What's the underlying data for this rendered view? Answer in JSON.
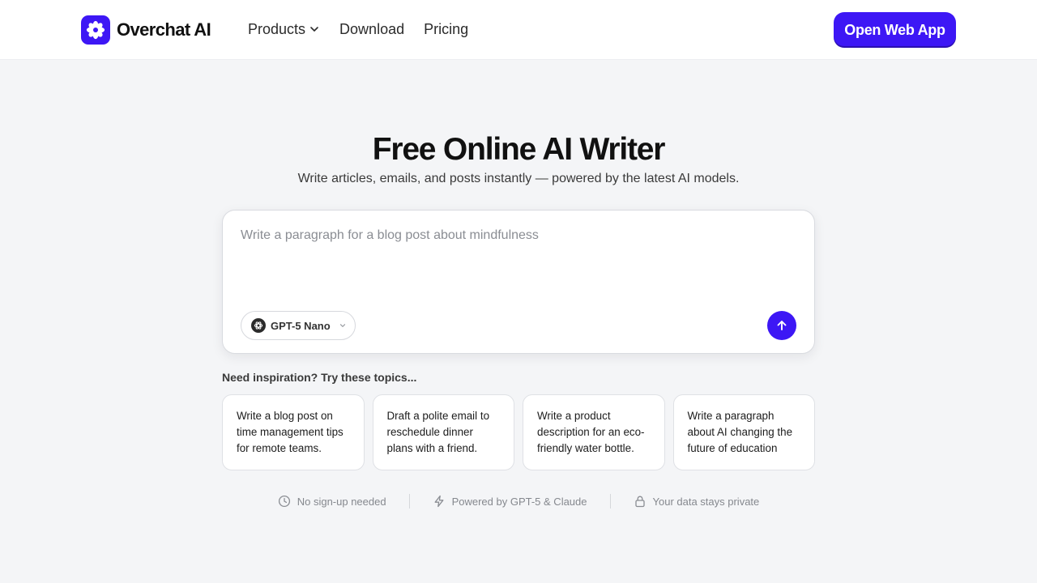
{
  "header": {
    "brand": "Overchat AI",
    "nav": [
      {
        "label": "Products"
      },
      {
        "label": "Download"
      },
      {
        "label": "Pricing"
      }
    ],
    "cta_label": "Open Web App"
  },
  "hero": {
    "title": "Free Online AI Writer",
    "subtitle": "Write articles, emails, and posts instantly — powered by the latest AI models."
  },
  "prompt": {
    "placeholder": "Write a paragraph for a blog post about mindfulness",
    "value": "",
    "model": "GPT-5 Nano"
  },
  "inspiration": {
    "heading": "Need inspiration? Try these topics...",
    "cards": [
      {
        "text": "Write a blog post on time management tips for remote teams."
      },
      {
        "text": "Draft a polite email to reschedule dinner plans with a friend."
      },
      {
        "text": "Write a product description for an eco-friendly water bottle."
      },
      {
        "text": "Write a paragraph about AI changing the future of education"
      }
    ]
  },
  "features": [
    {
      "icon": "clock-icon",
      "label": "No sign-up needed"
    },
    {
      "icon": "lightning-icon",
      "label": "Powered by GPT-5 & Claude"
    },
    {
      "icon": "lock-icon",
      "label": "Your data stays private"
    }
  ],
  "colors": {
    "accent": "#3d17f5",
    "background": "#f4f5f7"
  }
}
